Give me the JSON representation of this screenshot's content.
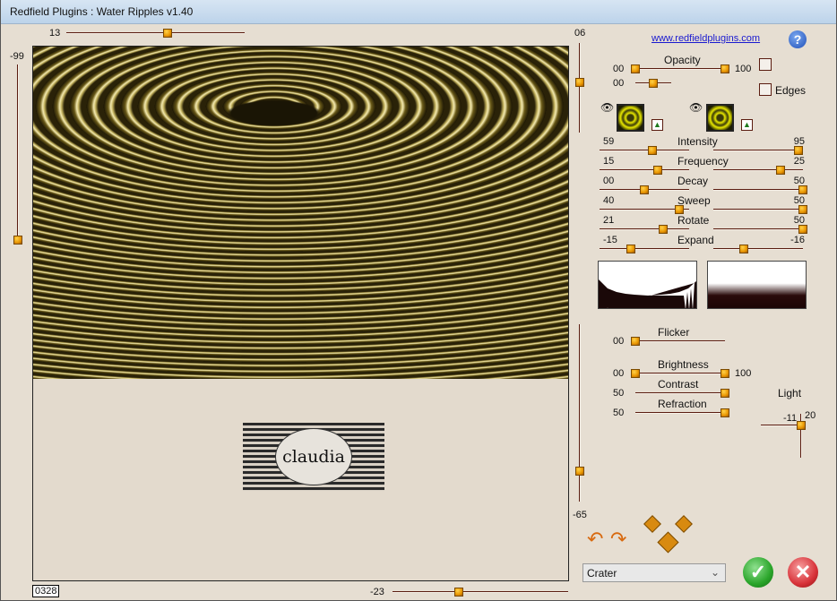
{
  "window": {
    "title": "Redfield Plugins : Water Ripples v1.40"
  },
  "preview": {
    "top_slider": {
      "value": "13",
      "fraction": 0.57
    },
    "left_slider": {
      "value": "-99",
      "fraction": 0.02
    },
    "bottom_slider": {
      "value": "-23",
      "fraction": 0.38
    },
    "zoom_readout": "0328",
    "logo_text": "claudia"
  },
  "right_vsliders": [
    {
      "value": "06",
      "fraction": 0.56
    },
    {
      "value": "-65",
      "fraction": 0.17
    }
  ],
  "link": "www.redfieldplugins.com",
  "opacity": {
    "label": "Opacity",
    "min": "00",
    "max": "100",
    "low": 0,
    "high": 1,
    "second_value": "00",
    "second_fraction": 0.5
  },
  "edges_label": "Edges",
  "params": [
    {
      "label": "Intensity",
      "left": "59",
      "right": "95",
      "lf": 0.59,
      "rf": 0.95
    },
    {
      "label": "Frequency",
      "left": "15",
      "right": "25",
      "lf": 0.65,
      "rf": 0.75
    },
    {
      "label": "Decay",
      "left": "00",
      "right": "50",
      "lf": 0.5,
      "rf": 1.0
    },
    {
      "label": "Sweep",
      "left": "40",
      "right": "50",
      "lf": 0.89,
      "rf": 1.0
    },
    {
      "label": "Rotate",
      "left": "21",
      "right": "50",
      "lf": 0.71,
      "rf": 1.0
    },
    {
      "label": "Expand",
      "left": "-15",
      "right": "-16",
      "lf": 0.35,
      "rf": 0.34
    }
  ],
  "flicker": {
    "label": "Flicker",
    "value": "00",
    "fraction": 0
  },
  "brightness": {
    "label": "Brightness",
    "min": "00",
    "max": "100"
  },
  "contrast": {
    "label": "Contrast",
    "value": "50",
    "fraction": 1
  },
  "refraction": {
    "label": "Refraction",
    "value": "50",
    "fraction": 1
  },
  "light": {
    "label": "Light",
    "x": "-11",
    "y": "20"
  },
  "preset": {
    "selected": "Crater"
  },
  "colors": {
    "thumb": "#e89400",
    "track": "#5a1c10",
    "ok": "#2aa52a",
    "cancel": "#d8333a"
  }
}
